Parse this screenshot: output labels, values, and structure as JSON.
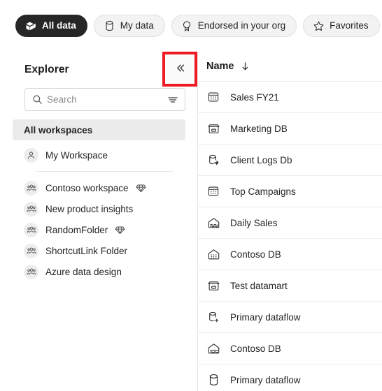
{
  "filter_bar": {
    "pills": [
      {
        "label": "All data",
        "icon": "stacked-layers-icon",
        "active": true
      },
      {
        "label": "My data",
        "icon": "database-cylinder-icon",
        "active": false
      },
      {
        "label": "Endorsed in your org",
        "icon": "endorsement-badge-icon",
        "active": false
      },
      {
        "label": "Favorites",
        "icon": "star-icon",
        "active": false
      }
    ]
  },
  "explorer": {
    "title": "Explorer",
    "collapse_button_label": "«",
    "collapse_icon": "double-chevron-left-icon",
    "highlight_color": "#ee1b24",
    "search": {
      "placeholder": "Search",
      "value": "",
      "search_icon": "search-icon",
      "filter_icon": "filter-lines-icon"
    },
    "workspaces": [
      {
        "label": "All workspaces",
        "selected": true,
        "icon": "none",
        "badge": ""
      },
      {
        "label": "My Workspace",
        "selected": false,
        "icon": "person-avatar-icon",
        "badge": ""
      },
      {
        "label": "Contoso workspace",
        "selected": false,
        "icon": "group-avatar-icon",
        "badge": "premium-diamond-icon"
      },
      {
        "label": "New product insights",
        "selected": false,
        "icon": "group-avatar-icon",
        "badge": ""
      },
      {
        "label": "RandomFolder",
        "selected": false,
        "icon": "group-avatar-icon",
        "badge": "premium-diamond-icon"
      },
      {
        "label": "ShortcutLink Folder",
        "selected": false,
        "icon": "group-avatar-icon",
        "badge": ""
      },
      {
        "label": "Azure data design",
        "selected": false,
        "icon": "group-avatar-icon",
        "badge": ""
      }
    ]
  },
  "content": {
    "column_header": "Name",
    "sort_direction": "descending",
    "sort_icon": "arrow-down-icon",
    "items": [
      {
        "label": "Sales FY21",
        "icon": "report-icon"
      },
      {
        "label": "Marketing DB",
        "icon": "datamart-icon"
      },
      {
        "label": "Client Logs Db",
        "icon": "dataflow-icon"
      },
      {
        "label": "Top Campaigns",
        "icon": "report-icon"
      },
      {
        "label": "Daily Sales",
        "icon": "lakehouse-icon"
      },
      {
        "label": "Contoso DB",
        "icon": "warehouse-icon"
      },
      {
        "label": "Test datamart",
        "icon": "datamart-icon"
      },
      {
        "label": "Primary dataflow",
        "icon": "dataflow-icon"
      },
      {
        "label": "Contoso DB",
        "icon": "lakehouse-icon"
      },
      {
        "label": "Primary dataflow",
        "icon": "dataset-icon"
      }
    ]
  }
}
